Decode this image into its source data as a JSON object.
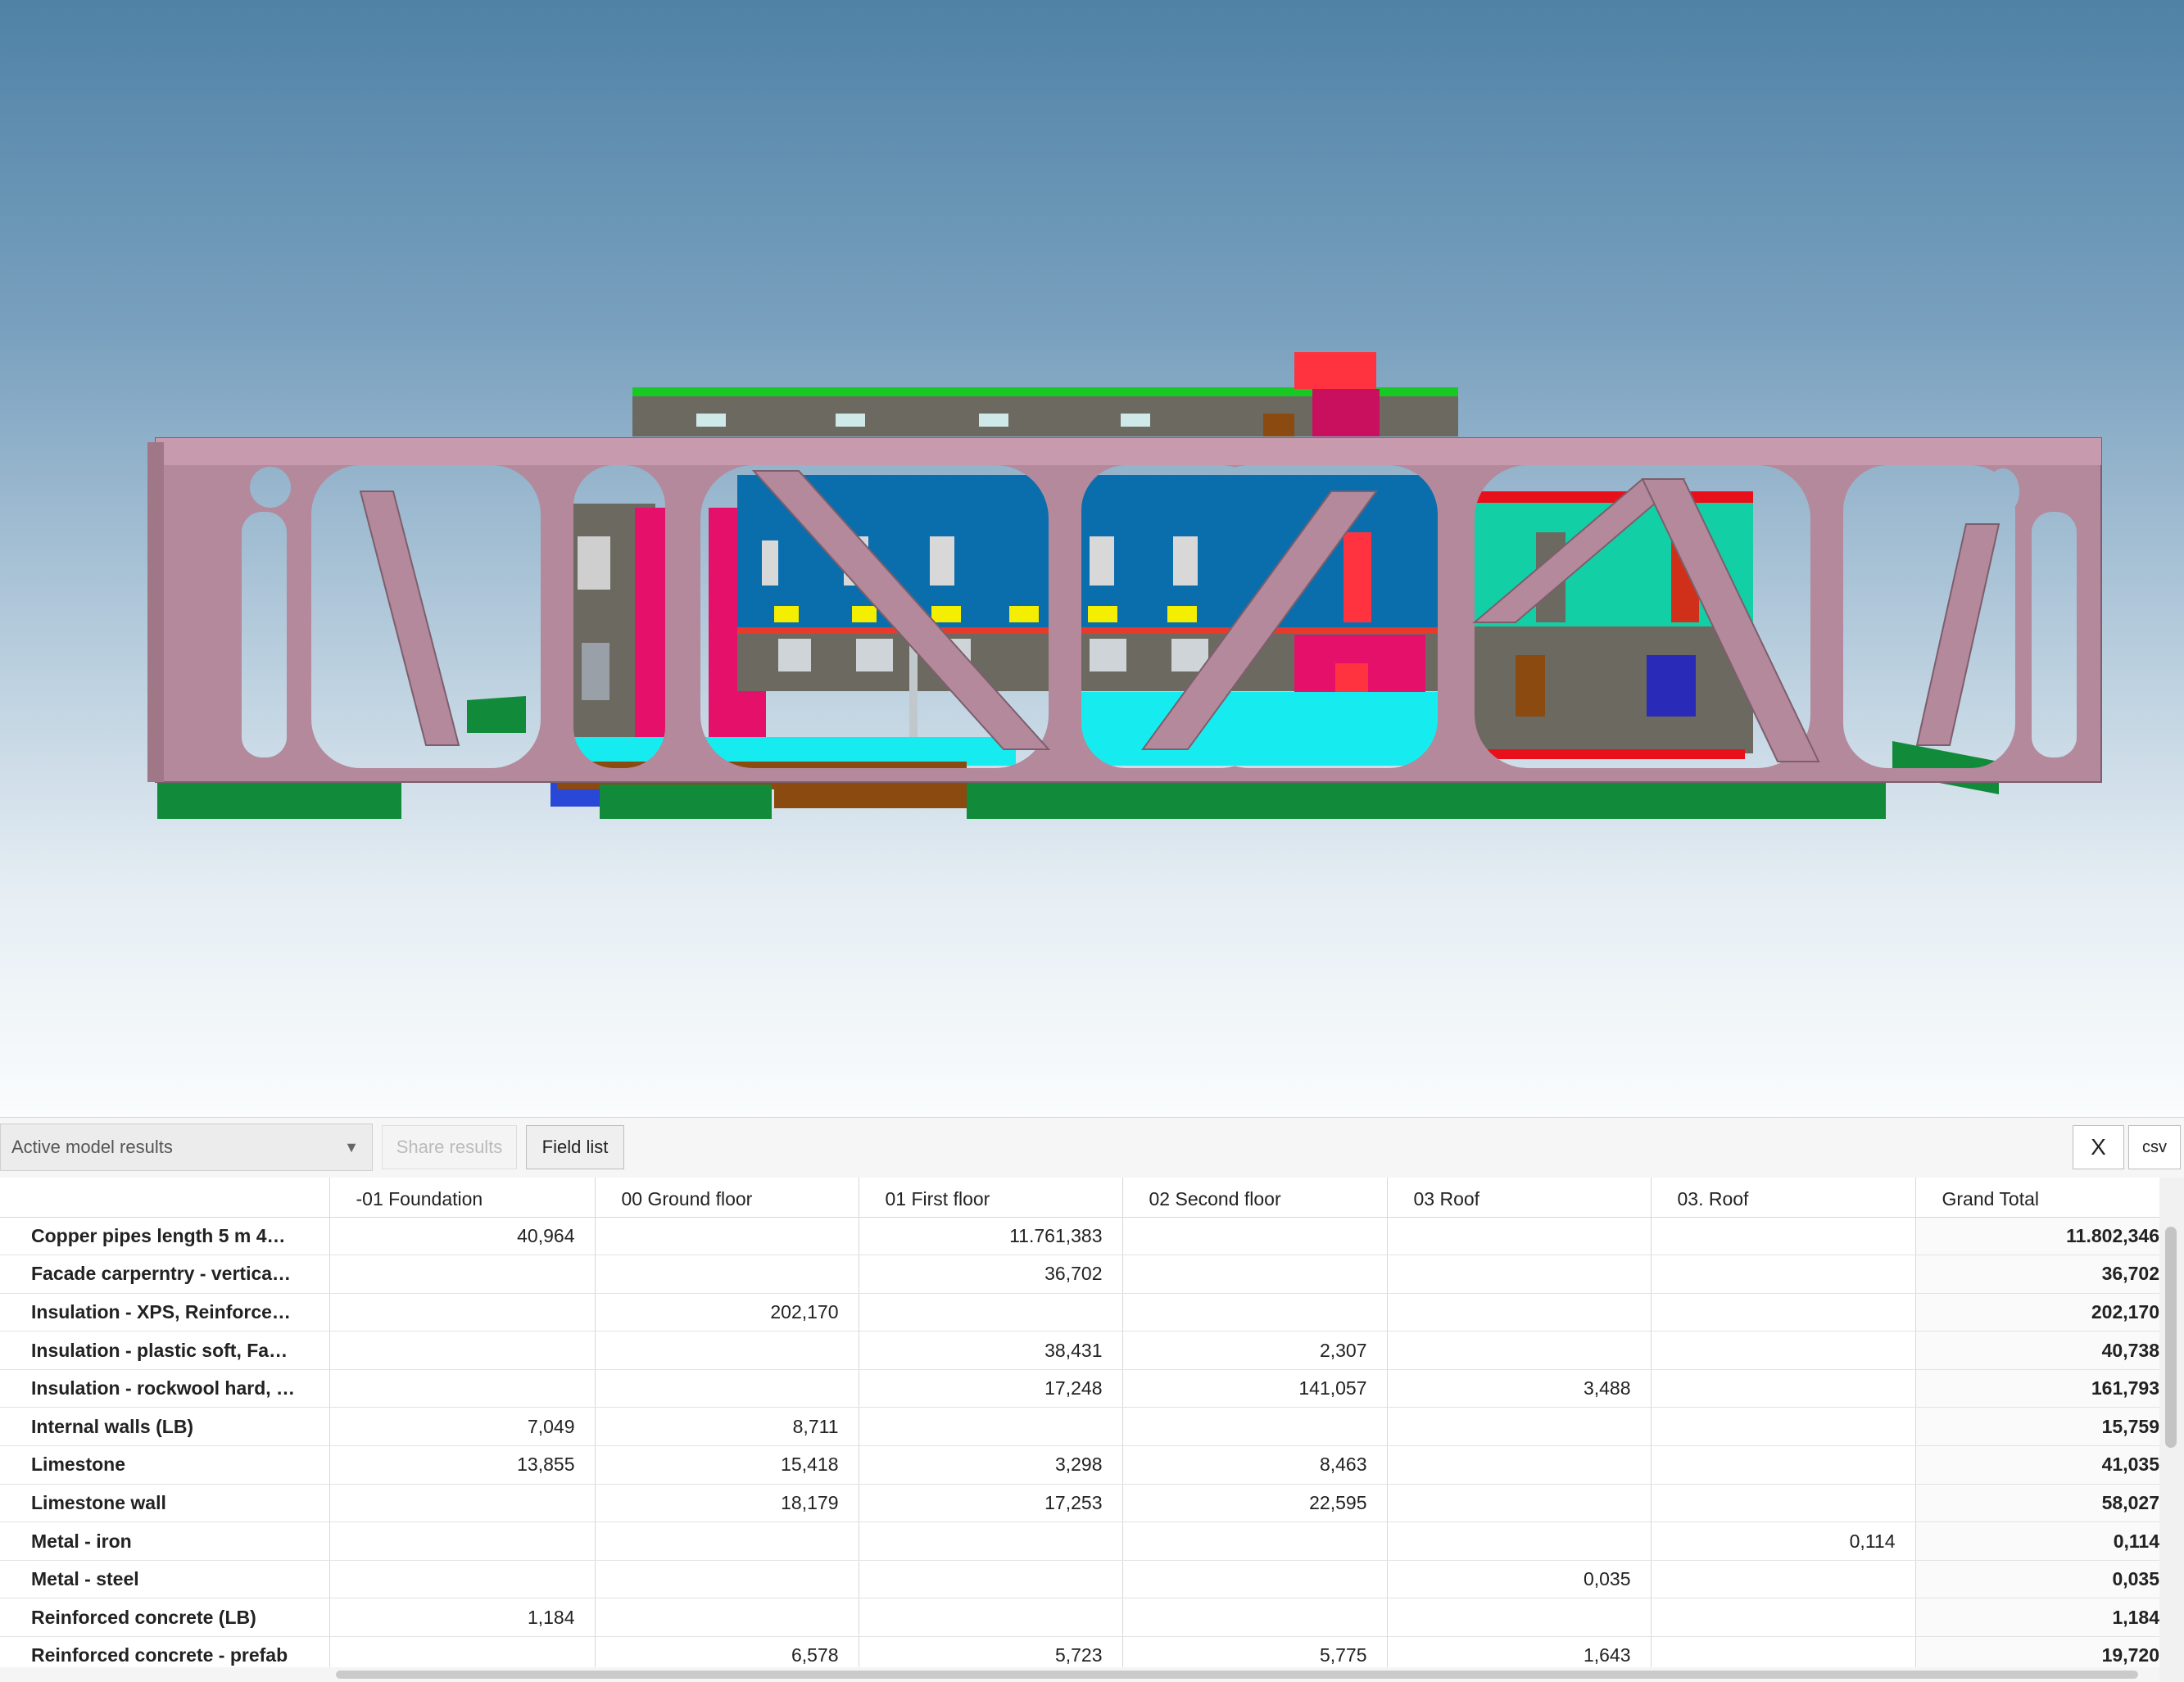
{
  "toolbar": {
    "results_select": "Active model results",
    "share_label": "Share results",
    "fieldlist_label": "Field list",
    "close_label": "X",
    "csv_label": "csv"
  },
  "table": {
    "columns": [
      "-01 Foundation",
      "00 Ground floor",
      "01 First floor",
      "02 Second floor",
      "03 Roof",
      "03. Roof",
      "Grand Total"
    ],
    "rows": [
      {
        "label": "Copper pipes length 5 m 4…",
        "cells": [
          "40,964",
          "",
          "11.761,383",
          "",
          "",
          "",
          "11.802,346"
        ]
      },
      {
        "label": "Facade carperntry - vertica…",
        "cells": [
          "",
          "",
          "36,702",
          "",
          "",
          "",
          "36,702"
        ]
      },
      {
        "label": "Insulation - XPS, Reinforce…",
        "cells": [
          "",
          "202,170",
          "",
          "",
          "",
          "",
          "202,170"
        ]
      },
      {
        "label": "Insulation - plastic soft, Fa…",
        "cells": [
          "",
          "",
          "38,431",
          "2,307",
          "",
          "",
          "40,738"
        ]
      },
      {
        "label": "Insulation - rockwool hard, …",
        "cells": [
          "",
          "",
          "17,248",
          "141,057",
          "3,488",
          "",
          "161,793"
        ]
      },
      {
        "label": "Internal walls (LB)",
        "cells": [
          "7,049",
          "8,711",
          "",
          "",
          "",
          "",
          "15,759"
        ]
      },
      {
        "label": "Limestone",
        "cells": [
          "13,855",
          "15,418",
          "3,298",
          "8,463",
          "",
          "",
          "41,035"
        ]
      },
      {
        "label": "Limestone wall",
        "cells": [
          "",
          "18,179",
          "17,253",
          "22,595",
          "",
          "",
          "58,027"
        ]
      },
      {
        "label": "Metal - iron",
        "cells": [
          "",
          "",
          "",
          "",
          "",
          "0,114",
          "0,114"
        ]
      },
      {
        "label": "Metal - steel",
        "cells": [
          "",
          "",
          "",
          "",
          "0,035",
          "",
          "0,035"
        ]
      },
      {
        "label": "Reinforced concrete (LB)",
        "cells": [
          "1,184",
          "",
          "",
          "",
          "",
          "",
          "1,184"
        ]
      },
      {
        "label": "Reinforced concrete - prefab",
        "cells": [
          "",
          "6,578",
          "5,723",
          "5,775",
          "1,643",
          "",
          "19,720"
        ]
      }
    ]
  },
  "model_colors": {
    "truss": "#b3899b",
    "foundation": "#118a3a",
    "wall_grey": "#6c6a60",
    "facade_blue": "#0a6ead",
    "floor_cyan": "#16ecf0",
    "accent_magenta": "#e4106a",
    "accent_red": "#ff3340",
    "accent_yellow": "#f4ee00",
    "accent_teal": "#12cfa5",
    "slab_brown": "#8a4a10"
  }
}
